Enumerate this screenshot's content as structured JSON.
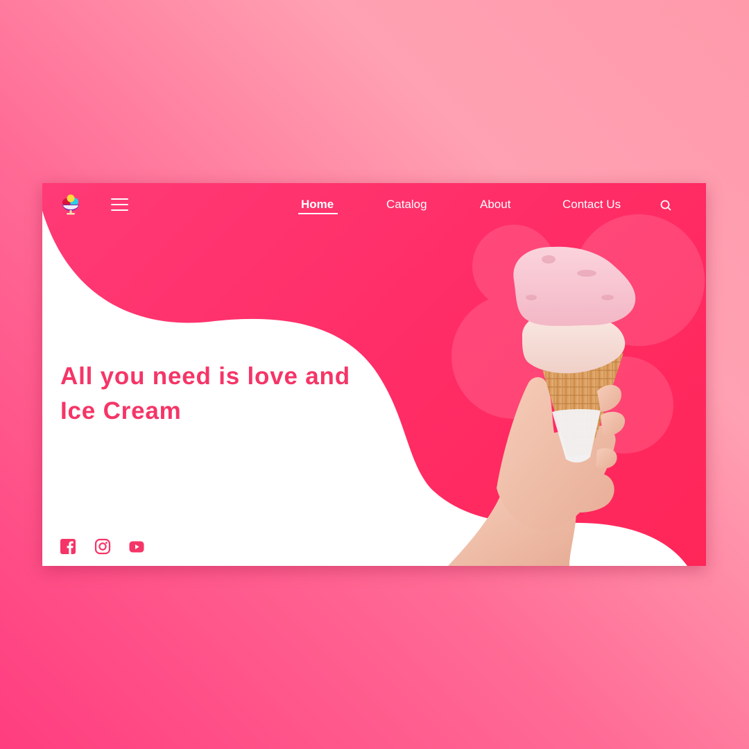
{
  "colors": {
    "accent": "#ff2d67",
    "headline": "#f53567",
    "nav_text": "#ffffff",
    "panel_white": "#ffffff"
  },
  "header": {
    "logo_icon": "ice-cream-sundae-icon",
    "menu_icon": "hamburger-menu-icon",
    "nav": {
      "home": "Home",
      "catalog": "Catalog",
      "about": "About",
      "contact": "Contact Us"
    },
    "active_nav": "Home",
    "search_icon": "search-icon"
  },
  "hero": {
    "headline": "All you need is love and Ice Cream",
    "image": "hand-holding-ice-cream-cone"
  },
  "social": [
    {
      "icon": "facebook-icon"
    },
    {
      "icon": "instagram-icon"
    },
    {
      "icon": "youtube-icon"
    }
  ]
}
